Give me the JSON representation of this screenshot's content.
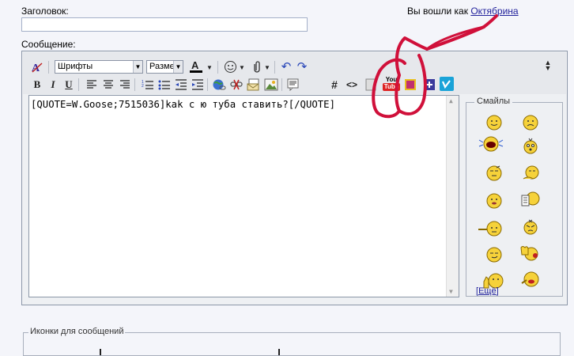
{
  "subject": {
    "label": "Заголовок:",
    "value": ""
  },
  "user": {
    "prefix": "Вы вошли как",
    "name": "Октябрина"
  },
  "message": {
    "label": "Сообщение:",
    "text": "[QUOTE=W.Goose;7515036]kak с ю туба ставить?[/QUOTE]"
  },
  "toolbar": {
    "font_select": "Шрифты",
    "size_select": "Разме",
    "youtube_top": "You",
    "youtube_bottom": "Tube",
    "hash": "#",
    "code": "<>",
    "bold": "B",
    "italic": "I",
    "underline": "U",
    "undo": "↶",
    "redo": "↷"
  },
  "smilies": {
    "title": "Смайлы",
    "more": "Ещё"
  },
  "post_icons": {
    "title": "Иконки для сообщений"
  },
  "colors": {
    "annotation": "#d0103a",
    "link": "#22229c"
  }
}
